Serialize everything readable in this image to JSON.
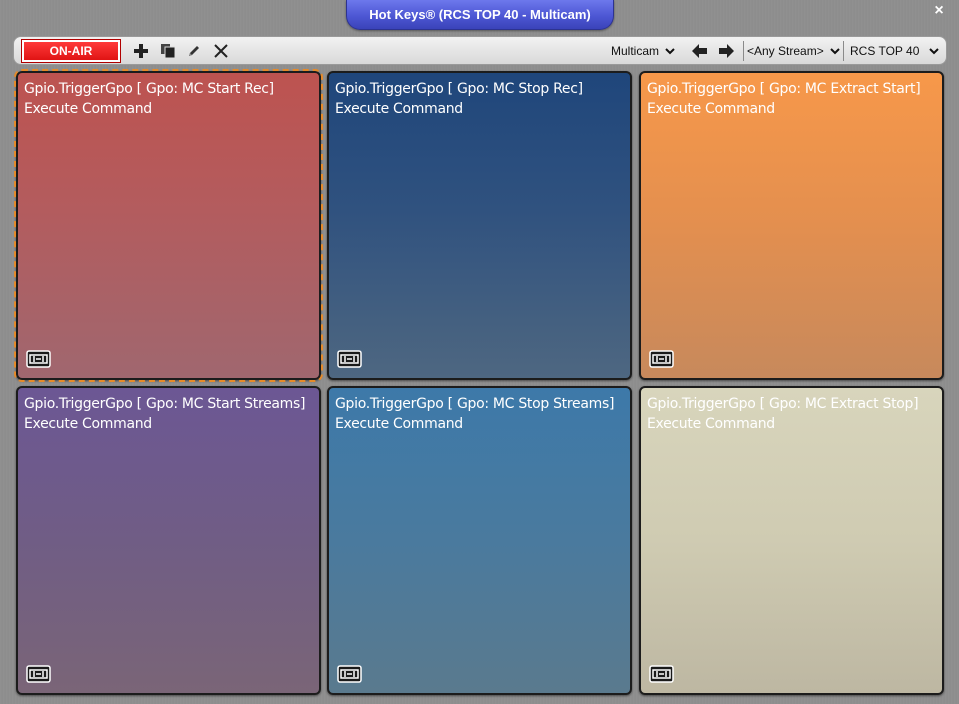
{
  "window": {
    "title": "Hot Keys® (RCS TOP 40 - Multicam)",
    "close_glyph": "×"
  },
  "toolbar": {
    "onair_label": "ON-AIR",
    "icons": [
      "add-icon",
      "copy-icon",
      "edit-icon",
      "delete-icon",
      "arrow-left-icon",
      "arrow-right-icon"
    ],
    "group_dropdown": "Multicam",
    "stream_dropdown": "<Any Stream>",
    "station_dropdown": "RCS TOP 40"
  },
  "tiles": [
    {
      "line1": "Gpio.TriggerGpo [ Gpo: MC Start Rec]",
      "line2": "Execute Command",
      "color": "#bd5350",
      "selected": true
    },
    {
      "line1": "Gpio.TriggerGpo [ Gpo: MC Stop Rec]",
      "line2": "Execute Command",
      "color": "#1f467b"
    },
    {
      "line1": "Gpio.TriggerGpo [ Gpo: MC Extract Start]",
      "line2": "Execute Command",
      "color": "#f7984a"
    },
    {
      "line1": "Gpio.TriggerGpo [ Gpo: MC Start Streams]",
      "line2": "Execute Command",
      "color": "#6c5794"
    },
    {
      "line1": "Gpio.TriggerGpo [ Gpo: MC Stop Streams]",
      "line2": "Execute Command",
      "color": "#3d79a9"
    },
    {
      "line1": "Gpio.TriggerGpo [ Gpo: MC Extract Stop]",
      "line2": "Execute Command",
      "color": "#d8d5bc"
    }
  ],
  "colors": {
    "title_tab": "#4d57d4",
    "onair": "#e01414",
    "selection_outline": "#e58a2a"
  }
}
